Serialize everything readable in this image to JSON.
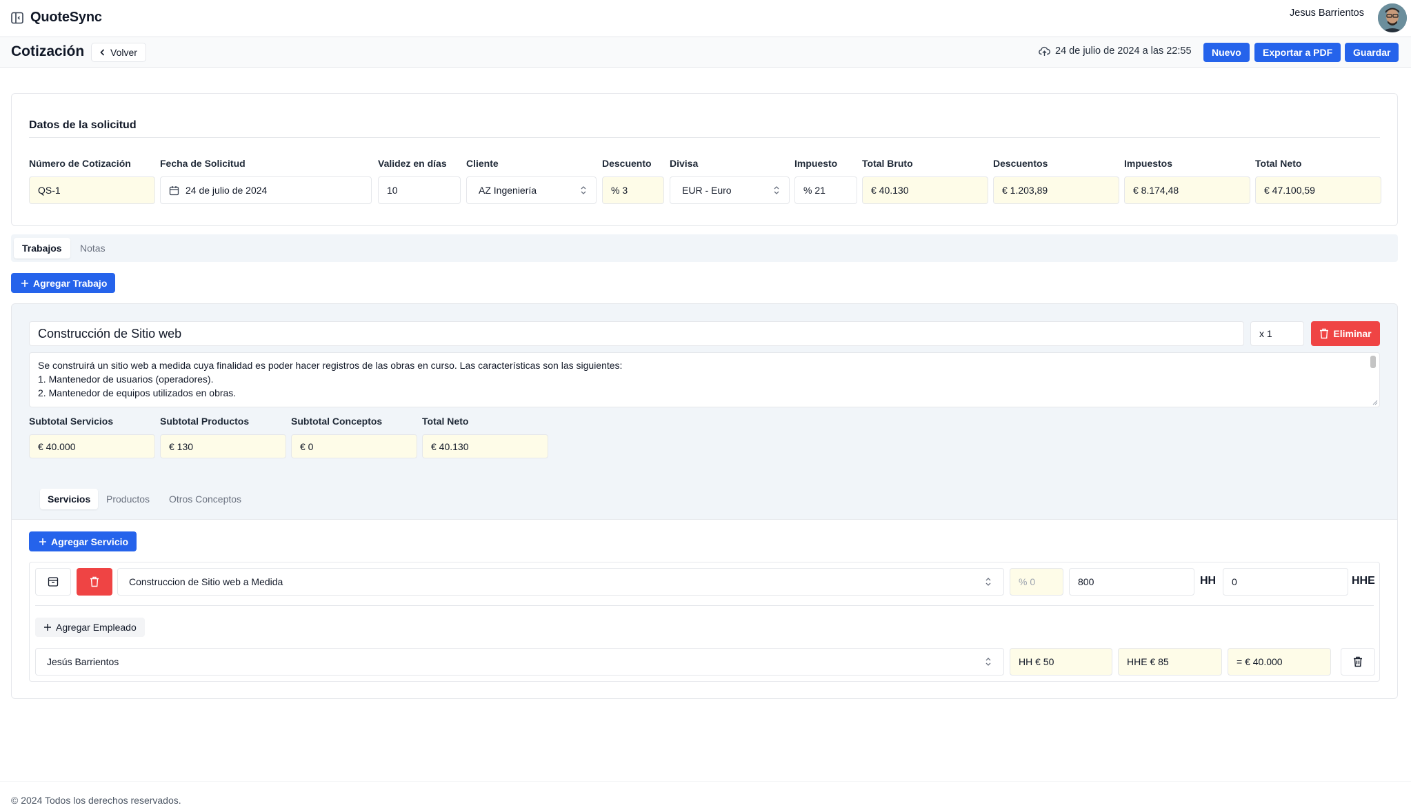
{
  "app": {
    "name": "QuoteSync"
  },
  "user": {
    "name": "Jesus Barrientos"
  },
  "page": {
    "title": "Cotización",
    "back_label": "Volver",
    "saved_at": "24 de julio de 2024 a las 22:55",
    "actions": {
      "new": "Nuevo",
      "export": "Exportar a PDF",
      "save": "Guardar"
    }
  },
  "request": {
    "title": "Datos de la solicitud",
    "fields": {
      "quote_number": {
        "label": "Número de Cotización",
        "value": "QS-1"
      },
      "request_date": {
        "label": "Fecha de Solicitud",
        "value": "24 de julio de 2024"
      },
      "validity": {
        "label": "Validez en días",
        "value": "10"
      },
      "client": {
        "label": "Cliente",
        "value": "AZ Ingeniería"
      },
      "discount": {
        "label": "Descuento",
        "value": "% 3"
      },
      "currency": {
        "label": "Divisa",
        "value": "EUR - Euro"
      },
      "tax": {
        "label": "Impuesto",
        "value": "% 21"
      },
      "gross_total": {
        "label": "Total Bruto",
        "value": "€ 40.130"
      },
      "discounts": {
        "label": "Descuentos",
        "value": "€ 1.203,89"
      },
      "taxes": {
        "label": "Impuestos",
        "value": "€ 8.174,48"
      },
      "net_total": {
        "label": "Total Neto",
        "value": "€ 47.100,59"
      }
    }
  },
  "tabs": {
    "works": "Trabajos",
    "notes": "Notas"
  },
  "add_work_label": "Agregar Trabajo",
  "work": {
    "title": "Construcción de Sitio web",
    "quantity": "x 1",
    "delete_label": "Eliminar",
    "description_lines": [
      "Se construirá un sitio web a medida cuya finalidad es poder hacer registros de las obras en curso. Las características son las siguientes:",
      "",
      "1. Mantenedor de usuarios (operadores).",
      "2. Mantenedor de equipos utilizados en obras."
    ],
    "subtotals": {
      "services": {
        "label": "Subtotal Servicios",
        "value": "€ 40.000"
      },
      "products": {
        "label": "Subtotal Productos",
        "value": "€ 130"
      },
      "concepts": {
        "label": "Subtotal Conceptos",
        "value": "€ 0"
      },
      "net": {
        "label": "Total Neto",
        "value": "€ 40.130"
      }
    },
    "subtabs": {
      "services": "Servicios",
      "products": "Productos",
      "other": "Otros Conceptos"
    },
    "add_service_label": "Agregar Servicio",
    "service": {
      "name": "Construccion de Sitio web a Medida",
      "discount_placeholder": "% 0",
      "hh": "800",
      "hh_unit": "HH",
      "hhe": "0",
      "hhe_unit": "HHE",
      "add_employee_label": "Agregar Empleado",
      "employee": {
        "name": "Jesús Barrientos",
        "hh_rate": "HH € 50",
        "hhe_rate": "HHE € 85",
        "total": "= € 40.000"
      }
    }
  },
  "footer": {
    "copyright": "© 2024 Todos los derechos reservados."
  },
  "colors": {
    "primary": "#2563eb",
    "danger": "#ef4444",
    "readonly_bg": "#fefce8"
  }
}
